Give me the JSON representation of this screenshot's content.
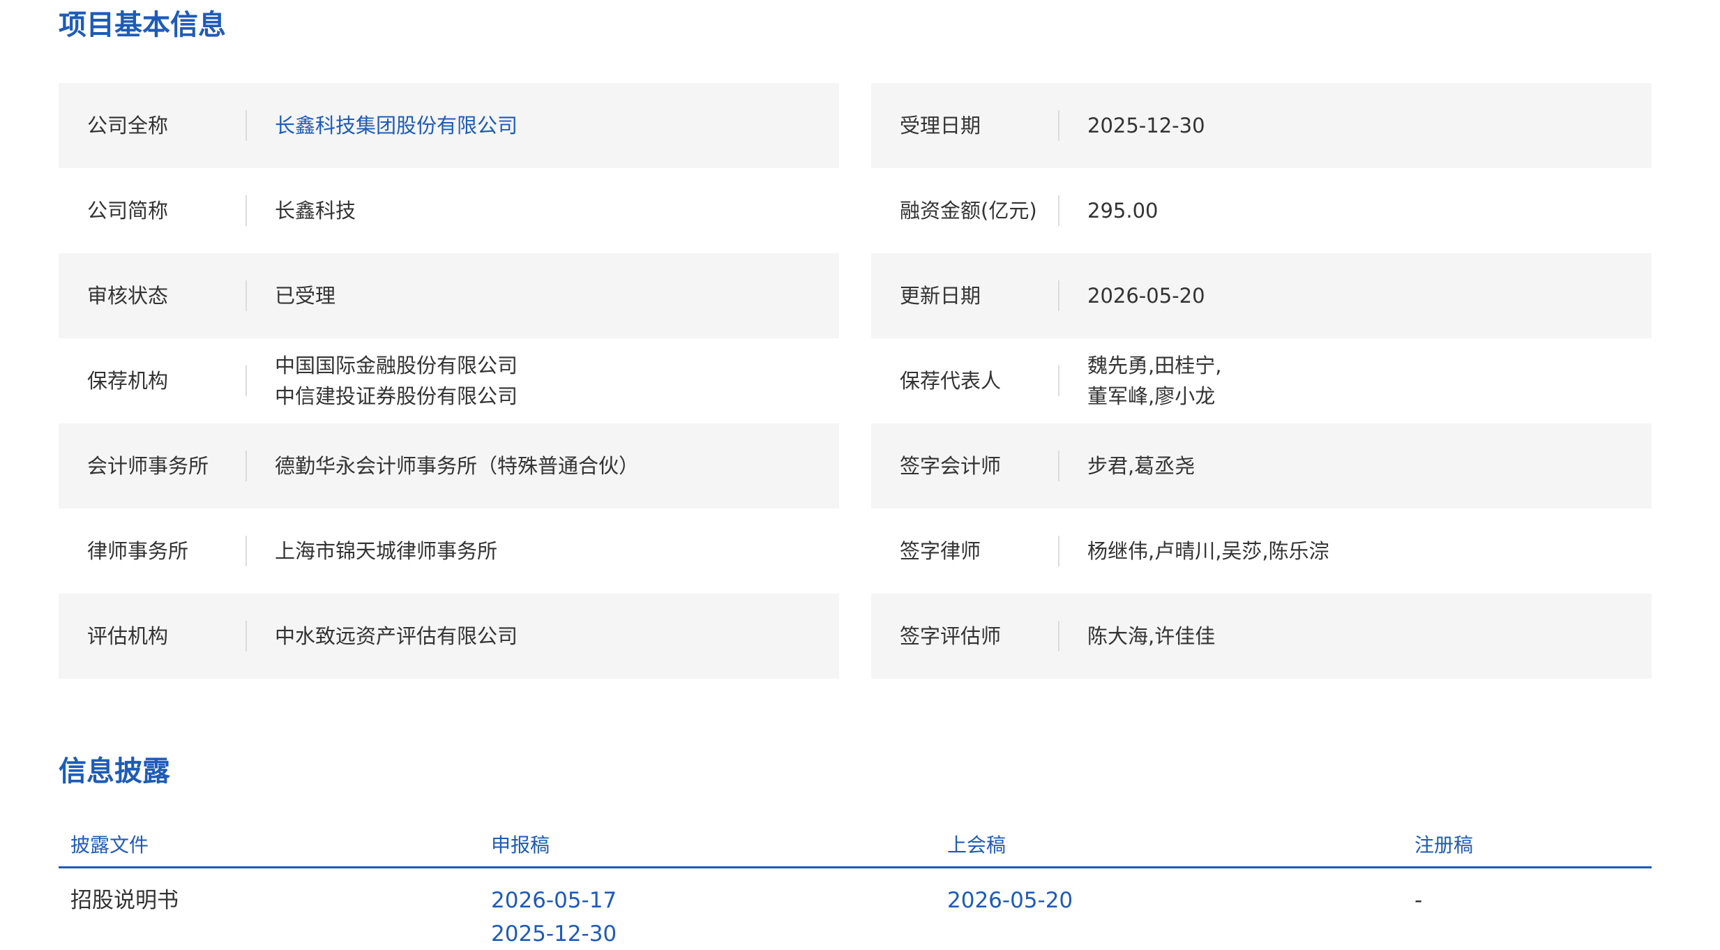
{
  "section_basic": {
    "title": "项目基本信息"
  },
  "info_rows": [
    {
      "left": {
        "label": "公司全称",
        "value": [
          "长鑫科技集团股份有限公司"
        ],
        "link": true
      },
      "right": {
        "label": "受理日期",
        "value": [
          "2025-12-30"
        ]
      }
    },
    {
      "left": {
        "label": "公司简称",
        "value": [
          "长鑫科技"
        ]
      },
      "right": {
        "label": "融资金额(亿元)",
        "value": [
          "295.00"
        ]
      }
    },
    {
      "left": {
        "label": "审核状态",
        "value": [
          "已受理"
        ]
      },
      "right": {
        "label": "更新日期",
        "value": [
          "2026-05-20"
        ]
      }
    },
    {
      "left": {
        "label": "保荐机构",
        "value": [
          "中国国际金融股份有限公司",
          "中信建投证券股份有限公司"
        ]
      },
      "right": {
        "label": "保荐代表人",
        "value": [
          "魏先勇,田桂宁,",
          "董军峰,廖小龙"
        ]
      }
    },
    {
      "left": {
        "label": "会计师事务所",
        "value": [
          "德勤华永会计师事务所（特殊普通合伙）"
        ]
      },
      "right": {
        "label": "签字会计师",
        "value": [
          "步君,葛丞尧"
        ]
      }
    },
    {
      "left": {
        "label": "律师事务所",
        "value": [
          "上海市锦天城律师事务所"
        ]
      },
      "right": {
        "label": "签字律师",
        "value": [
          "杨继伟,卢晴川,吴莎,陈乐淙"
        ]
      }
    },
    {
      "left": {
        "label": "评估机构",
        "value": [
          "中水致远资产评估有限公司"
        ]
      },
      "right": {
        "label": "签字评估师",
        "value": [
          "陈大海,许佳佳"
        ]
      }
    }
  ],
  "section_disclosure": {
    "title": "信息披露",
    "columns": [
      "披露文件",
      "申报稿",
      "上会稿",
      "注册稿"
    ],
    "rows": [
      {
        "document": "招股说明书",
        "filing": [
          "2026-05-17",
          "2025-12-30"
        ],
        "meeting": [
          "2026-05-20"
        ],
        "registration": [
          "-"
        ]
      }
    ]
  },
  "colors": {
    "accent": "#1e5bb8",
    "text": "#333333",
    "row_shade": "#f5f5f5",
    "divider": "#dcdcdc"
  }
}
